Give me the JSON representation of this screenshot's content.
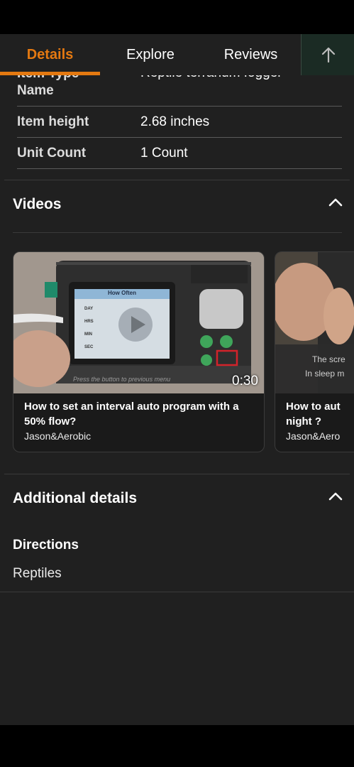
{
  "tabs": [
    {
      "label": "Details"
    },
    {
      "label": "Explore"
    },
    {
      "label": "Reviews"
    }
  ],
  "specs": [
    {
      "label": "Item Type\nName",
      "value": "Reptile terrarium fogger"
    },
    {
      "label": "Item height",
      "value": "2.68 inches"
    },
    {
      "label": "Unit Count",
      "value": "1 Count"
    }
  ],
  "videos": {
    "title": "Videos",
    "items": [
      {
        "title": "How to set an interval auto program with a 50% flow?",
        "author": "Jason&Aerobic",
        "duration": "0:30",
        "screen_title": "How Often",
        "screen_rows": [
          "DAY",
          "HRS",
          "MIN",
          "SEC"
        ],
        "caption": "Press the button to previous menu"
      },
      {
        "title": "How to aut... night ?",
        "title_line1": "How to aut",
        "title_line2": "night ?",
        "author": "Jason&Aero",
        "overlay1": "The scre",
        "overlay2": "In sleep m"
      }
    ]
  },
  "additional": {
    "title": "Additional details",
    "directions_label": "Directions",
    "directions_value": "Reptiles"
  },
  "colors": {
    "accent": "#e47911",
    "background": "#202020",
    "up_button_bg": "#1b2b24"
  }
}
